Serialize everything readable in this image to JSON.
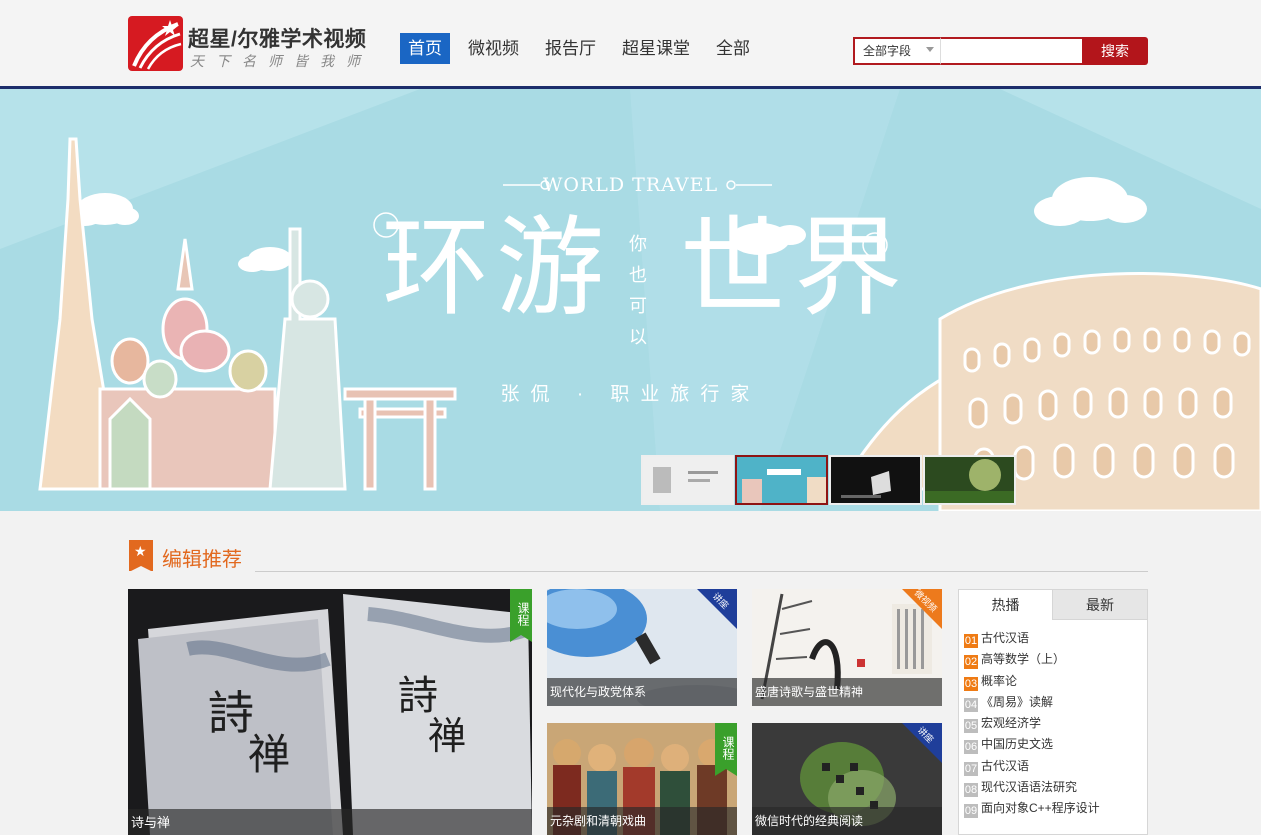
{
  "header": {
    "logo_title": "超星/尔雅学术视频",
    "logo_subtitle": "天下名师皆我师",
    "nav": [
      {
        "label": "首页",
        "active": true
      },
      {
        "label": "微视频",
        "active": false
      },
      {
        "label": "报告厅",
        "active": false
      },
      {
        "label": "超星课堂",
        "active": false
      },
      {
        "label": "全部",
        "active": false
      }
    ],
    "search": {
      "scope_selected": "全部字段",
      "input_value": "",
      "button_label": "搜索"
    }
  },
  "banner": {
    "english_title": "WORLD TRAVEL",
    "title_left": "环游",
    "title_right": "世界",
    "vertical_text": [
      "你",
      "也",
      "可",
      "以"
    ],
    "author": "张侃 · 职业旅行家",
    "active_thumb": 1
  },
  "section": {
    "title": "编辑推荐",
    "icon": "star-bookmark-icon"
  },
  "cards": [
    {
      "caption": "诗与禅",
      "badge": "课程"
    },
    {
      "caption": "现代化与政党体系",
      "badge": "讲座"
    },
    {
      "caption": "盛唐诗歌与盛世精神",
      "badge": "微视频"
    },
    {
      "caption": "元杂剧和清朝戏曲",
      "badge": "课程"
    },
    {
      "caption": "微信时代的经典阅读",
      "badge": "讲座"
    }
  ],
  "side_panel": {
    "tabs": [
      {
        "label": "热播",
        "active": true
      },
      {
        "label": "最新",
        "active": false
      }
    ],
    "items": [
      {
        "rank": "01",
        "title": "古代汉语"
      },
      {
        "rank": "02",
        "title": "高等数学（上）"
      },
      {
        "rank": "03",
        "title": "概率论"
      },
      {
        "rank": "04",
        "title": "《周易》读解"
      },
      {
        "rank": "05",
        "title": "宏观经济学"
      },
      {
        "rank": "06",
        "title": "中国历史文选"
      },
      {
        "rank": "07",
        "title": "古代汉语"
      },
      {
        "rank": "08",
        "title": "现代汉语语法研究"
      },
      {
        "rank": "09",
        "title": "面向对象C++程序设计"
      }
    ]
  },
  "colors": {
    "nav_active": "#1a66c4",
    "brand_red": "#b3151b",
    "header_rule": "#1c2d6b",
    "section_orange": "#e2691f",
    "badge_green": "#3aa02b",
    "badge_blue": "#1f3e9a",
    "badge_orange": "#ed7a1c",
    "banner_sky": "#a9dbe4"
  }
}
